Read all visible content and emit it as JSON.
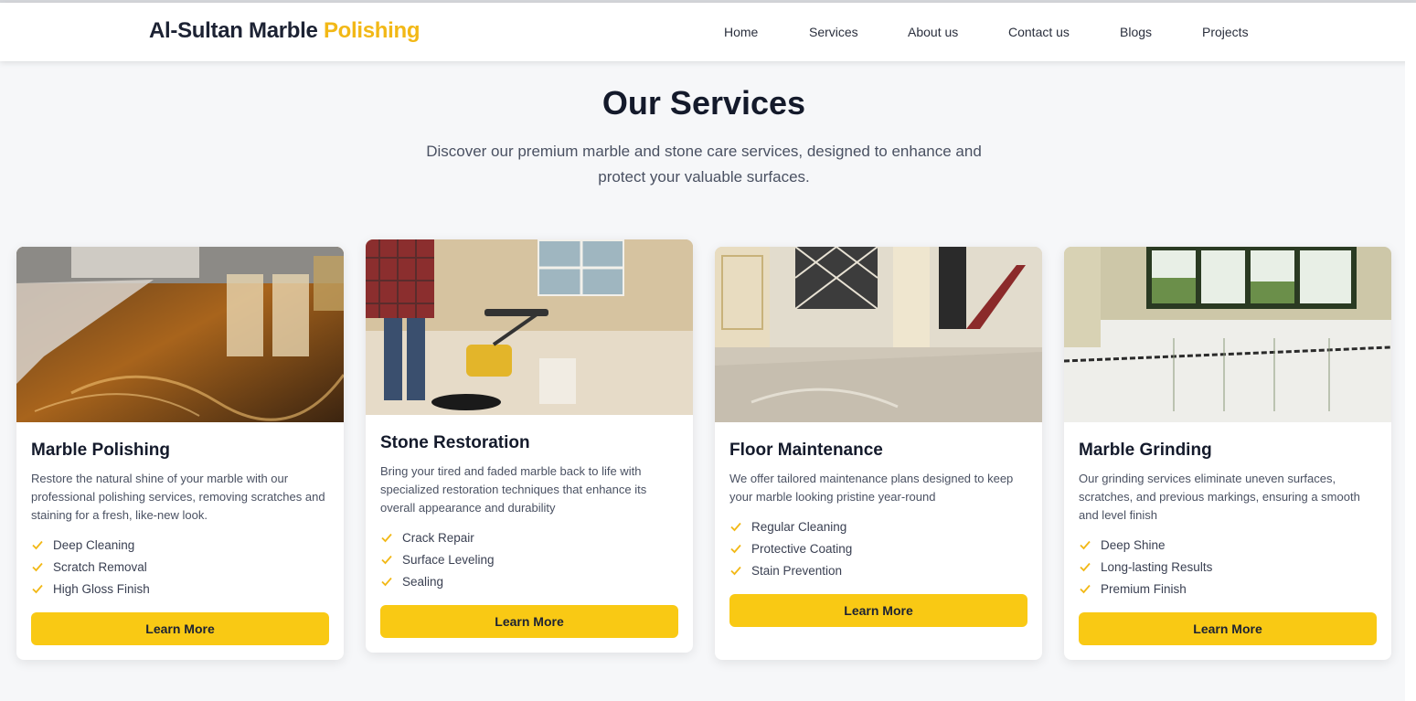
{
  "brand": {
    "name_main": "Al-Sultan Marble",
    "name_accent": "Polishing",
    "accent_color": "#f2b816"
  },
  "nav": {
    "items": [
      {
        "label": "Home"
      },
      {
        "label": "Services"
      },
      {
        "label": "About us"
      },
      {
        "label": "Contact us"
      },
      {
        "label": "Blogs"
      },
      {
        "label": "Projects"
      }
    ]
  },
  "section": {
    "title": "Our Services",
    "subtitle": "Discover our premium marble and stone care services, designed to enhance and protect your valuable surfaces."
  },
  "cards": [
    {
      "title": "Marble Polishing",
      "description": "Restore the natural shine of your marble with our professional polishing services, removing scratches and staining for a fresh, like-new look.",
      "features": [
        "Deep Cleaning",
        "Scratch Removal",
        "High Gloss Finish"
      ],
      "button": "Learn More"
    },
    {
      "title": "Stone Restoration",
      "description": "Bring your tired and faded marble back to life with specialized restoration techniques that enhance its overall appearance and durability",
      "features": [
        "Crack Repair",
        "Surface Leveling",
        "Sealing"
      ],
      "button": "Learn More"
    },
    {
      "title": "Floor Maintenance",
      "description": "We offer tailored maintenance plans designed to keep your marble looking pristine year-round",
      "features": [
        "Regular Cleaning",
        "Protective Coating",
        "Stain Prevention"
      ],
      "button": "Learn More"
    },
    {
      "title": "Marble Grinding",
      "description": "Our grinding services eliminate uneven surfaces, scratches, and previous markings, ensuring a smooth and level finish",
      "features": [
        "Deep Shine",
        "Long-lasting Results",
        "Premium Finish"
      ],
      "button": "Learn More"
    }
  ],
  "colors": {
    "button": "#f9c914",
    "check": "#f2b816",
    "background": "#f6f7f9"
  }
}
